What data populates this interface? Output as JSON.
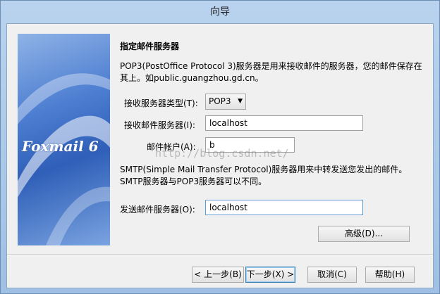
{
  "window": {
    "title": "向导"
  },
  "banner": {
    "brand": "Foxmail 6"
  },
  "page": {
    "heading": "指定邮件服务器",
    "description": "POP3(PostOffice Protocol 3)服务器是用来接收邮件的服务器，您的邮件保存在其上。如public.guangzhou.gd.cn。",
    "smtp_note_line1": "SMTP(Simple Mail Transfer Protocol)服务器用来中转发送您发出的邮件。",
    "smtp_note_line2": "SMTP服务器与POP3服务器可以不同。"
  },
  "form": {
    "server_type_label": "接收服务器类型(T):",
    "server_type_value": "POP3",
    "incoming_label": "接收邮件服务器(I):",
    "incoming_value": "localhost",
    "account_label": "邮件帐户(A):",
    "account_value": "b",
    "outgoing_label": "发送邮件服务器(O):",
    "outgoing_value": "localhost"
  },
  "watermark": "http://blog.csdn.net/",
  "buttons": {
    "advanced": "高级(D)...",
    "back": "< 上一步(B)",
    "next": "下一步(X) >",
    "cancel": "取消(C)",
    "help": "帮助(H)"
  }
}
